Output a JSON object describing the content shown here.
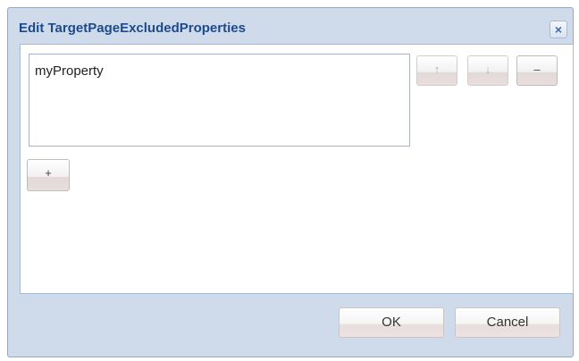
{
  "dialog": {
    "title": "Edit TargetPageExcludedProperties",
    "close_icon": "×"
  },
  "list": {
    "items": [
      "myProperty"
    ]
  },
  "toolbar": {
    "up_label": "↑",
    "down_label": "↓",
    "remove_label": "–",
    "add_label": "+"
  },
  "footer": {
    "ok_label": "OK",
    "cancel_label": "Cancel"
  }
}
